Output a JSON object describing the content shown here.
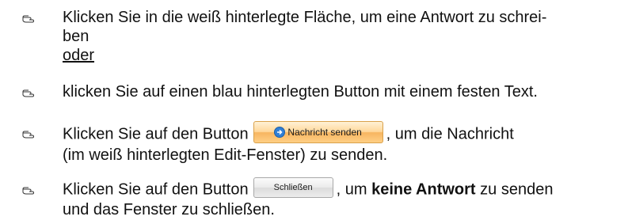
{
  "items": [
    {
      "line1": "Klicken Sie in die weiß hinterlegte Fläche, um eine Antwort zu schrei-",
      "line2": "ben",
      "line3": "oder"
    },
    {
      "line1": "klicken Sie auf einen blau hinterlegten Button mit einem festen Text."
    },
    {
      "before": "Klicken Sie auf den Button",
      "button_label": "Nachricht senden",
      "after": ", um die Nachricht",
      "line2": "(im weiß hinterlegten Edit-Fenster) zu senden."
    },
    {
      "before": "Klicken Sie auf den Button",
      "button_label": "Schließen",
      "after_prefix": ", um",
      "after_bold": "keine Antwort",
      "after_suffix": "zu senden",
      "line2": "und das Fenster zu schließen."
    }
  ],
  "icons": {
    "bullet": "pointing-hand-icon",
    "send": "blue-arrow-circle-icon"
  },
  "colors": {
    "send_button": "#f7b560",
    "close_button": "#e6e6e6",
    "send_icon": "#2f7fd6"
  }
}
